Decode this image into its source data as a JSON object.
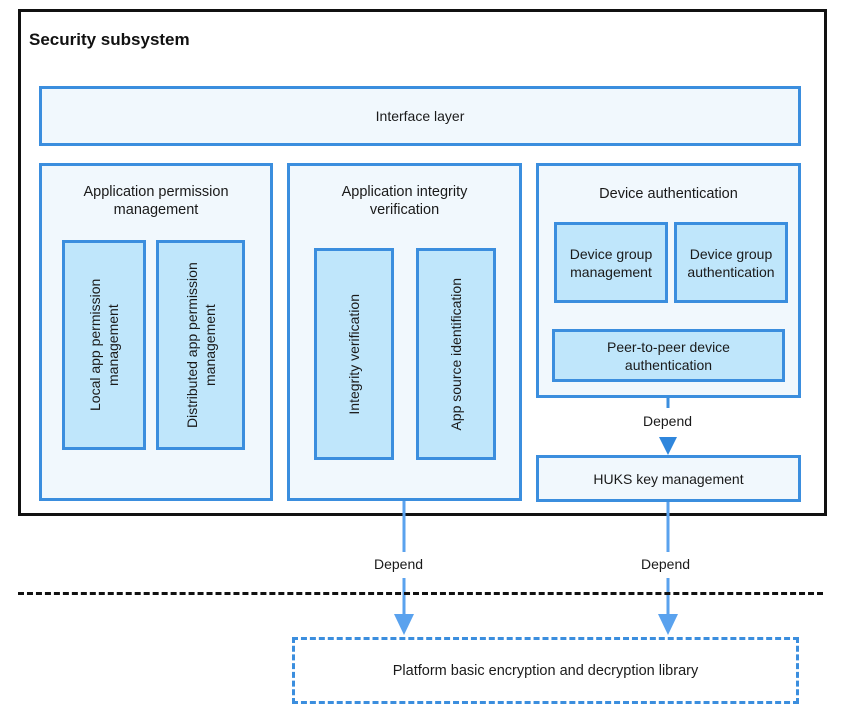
{
  "diagram": {
    "title": "Security subsystem",
    "interface_layer": "Interface  layer",
    "groups": [
      {
        "title": "Application permission management",
        "items": [
          "Local app permission management",
          "Distributed app permission management"
        ]
      },
      {
        "title": "Application integrity verification",
        "items": [
          "Integrity verification",
          "App source identification"
        ]
      },
      {
        "title": "Device authentication",
        "items": [
          "Device group management",
          "Device group authentication",
          "Peer-to-peer device authentication"
        ]
      }
    ],
    "huks": "HUKS key management",
    "platform": "Platform basic encryption  and decryption library",
    "edges": [
      {
        "from": "Device authentication",
        "to": "HUKS key management",
        "label": "Depend"
      },
      {
        "from": "Application integrity verification",
        "to": "Platform basic encryption and decryption library",
        "label": "Depend"
      },
      {
        "from": "HUKS key management",
        "to": "Platform basic encryption and decryption library",
        "label": "Depend"
      }
    ],
    "colors": {
      "accent": "#3b8ede",
      "box_fill": "#f1f8fd",
      "inner_fill": "#bfe6fb",
      "arrow": "#5aa2ee"
    }
  }
}
